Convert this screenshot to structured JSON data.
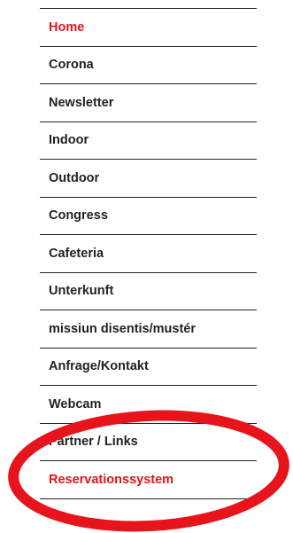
{
  "nav": {
    "items": [
      {
        "label": "Home",
        "state": "active"
      },
      {
        "label": "Corona",
        "state": ""
      },
      {
        "label": "Newsletter",
        "state": ""
      },
      {
        "label": "Indoor",
        "state": ""
      },
      {
        "label": "Outdoor",
        "state": ""
      },
      {
        "label": "Congress",
        "state": ""
      },
      {
        "label": "Cafeteria",
        "state": ""
      },
      {
        "label": "Unterkunft",
        "state": ""
      },
      {
        "label": "missiun disentis/mustér",
        "state": ""
      },
      {
        "label": "Anfrage/Kontakt",
        "state": ""
      },
      {
        "label": "Webcam",
        "state": ""
      },
      {
        "label": "Partner / Links",
        "state": ""
      },
      {
        "label": "Reservationssystem",
        "state": "highlight"
      }
    ]
  },
  "colors": {
    "accent": "#e5131b",
    "text": "#222222",
    "divider": "#222222",
    "annotation_ring": "#e8141c"
  }
}
